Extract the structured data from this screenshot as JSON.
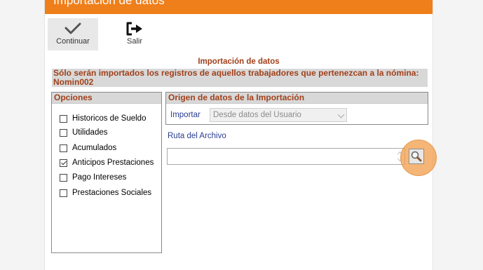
{
  "window": {
    "title": "Importación de datos"
  },
  "toolbar": {
    "continuar_label": "Continuar",
    "salir_label": "Salir",
    "continuar_icon": "checkmark-icon",
    "salir_icon": "exit-icon"
  },
  "main": {
    "heading": "Importación de datos",
    "notice_line1": "Sólo serán importados los registros de aquellos trabajadores que pertenezcan a la nómina:",
    "notice_line2": "Nomin002"
  },
  "opciones": {
    "title": "Opciones",
    "items": [
      {
        "label": "Historicos de Sueldo",
        "checked": false
      },
      {
        "label": "Utilidades",
        "checked": false
      },
      {
        "label": "Acumulados",
        "checked": false
      },
      {
        "label": "Anticipos Prestaciones",
        "checked": true
      },
      {
        "label": "Pago Intereses",
        "checked": false
      },
      {
        "label": "Prestaciones Sociales",
        "checked": false
      }
    ]
  },
  "origen": {
    "title": "Origen de datos de la Importación",
    "importar_label": "Importar",
    "importar_value": "Desde datos del Usuario"
  },
  "ruta": {
    "label": "Ruta del Archivo",
    "value": ""
  },
  "colors": {
    "titlebar": "#ef7f1a",
    "heading_text": "#a1401a",
    "label_blue": "#2a3d8f",
    "group_header_bg": "#d8d8d8",
    "highlight": "#f2a050"
  }
}
